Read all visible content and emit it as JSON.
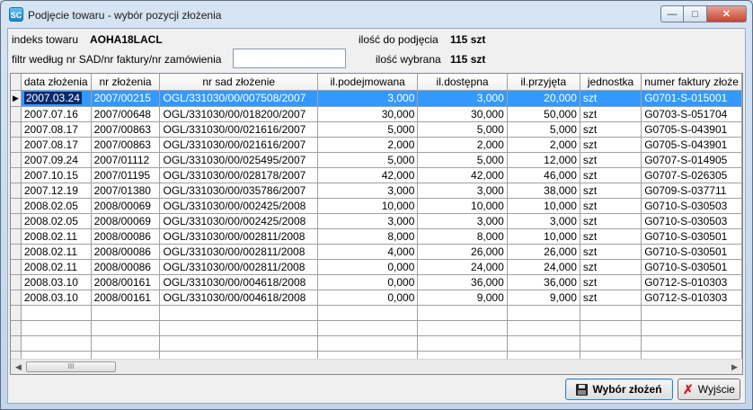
{
  "window": {
    "title": "Podjęcie towaru - wybór pozycji złożenia",
    "app_icon": "SC"
  },
  "header": {
    "index_label": "indeks towaru",
    "index_value": "AOHA18LACL",
    "qty_label": "ilość do podjęcia",
    "qty_value": "115 szt",
    "filter_label": "filtr według nr SAD/nr faktury/nr zamówienia",
    "filter_value": "",
    "selected_label": "ilość wybrana",
    "selected_value": "115 szt"
  },
  "grid": {
    "columns": [
      "data złożenia",
      "nr złożenia",
      "nr sad złożenie",
      "il.podejmowana",
      "il.dostępna",
      "il.przyjęta",
      "jednostka",
      "numer faktury złoże"
    ],
    "rows": [
      [
        "2007.03.24",
        "2007/00215",
        "OGL/331030/00/007508/2007",
        "3,000",
        "3,000",
        "20,000",
        "szt",
        "G0701-S-015001"
      ],
      [
        "2007.07.16",
        "2007/00648",
        "OGL/331030/00/018200/2007",
        "30,000",
        "30,000",
        "50,000",
        "szt",
        "G0703-S-051704"
      ],
      [
        "2007.08.17",
        "2007/00863",
        "OGL/331030/00/021616/2007",
        "5,000",
        "5,000",
        "5,000",
        "szt",
        "G0705-S-043901"
      ],
      [
        "2007.08.17",
        "2007/00863",
        "OGL/331030/00/021616/2007",
        "2,000",
        "2,000",
        "2,000",
        "szt",
        "G0705-S-043901"
      ],
      [
        "2007.09.24",
        "2007/01112",
        "OGL/331030/00/025495/2007",
        "5,000",
        "5,000",
        "12,000",
        "szt",
        "G0707-S-014905"
      ],
      [
        "2007.10.15",
        "2007/01195",
        "OGL/331030/00/028178/2007",
        "42,000",
        "42,000",
        "46,000",
        "szt",
        "G0707-S-026305"
      ],
      [
        "2007.12.19",
        "2007/01380",
        "OGL/331030/00/035786/2007",
        "3,000",
        "3,000",
        "38,000",
        "szt",
        "G0709-S-037711"
      ],
      [
        "2008.02.05",
        "2008/00069",
        "OGL/331030/00/002425/2008",
        "10,000",
        "10,000",
        "10,000",
        "szt",
        "G0710-S-030503"
      ],
      [
        "2008.02.05",
        "2008/00069",
        "OGL/331030/00/002425/2008",
        "3,000",
        "3,000",
        "3,000",
        "szt",
        "G0710-S-030503"
      ],
      [
        "2008.02.11",
        "2008/00086",
        "OGL/331030/00/002811/2008",
        "8,000",
        "8,000",
        "10,000",
        "szt",
        "G0710-S-030501"
      ],
      [
        "2008.02.11",
        "2008/00086",
        "OGL/331030/00/002811/2008",
        "4,000",
        "26,000",
        "26,000",
        "szt",
        "G0710-S-030501"
      ],
      [
        "2008.02.11",
        "2008/00086",
        "OGL/331030/00/002811/2008",
        "0,000",
        "24,000",
        "24,000",
        "szt",
        "G0710-S-030501"
      ],
      [
        "2008.03.10",
        "2008/00161",
        "OGL/331030/00/004618/2008",
        "0,000",
        "36,000",
        "36,000",
        "szt",
        "G0712-S-010303"
      ],
      [
        "2008.03.10",
        "2008/00161",
        "OGL/331030/00/004618/2008",
        "0,000",
        "9,000",
        "9,000",
        "szt",
        "G0712-S-010303"
      ]
    ],
    "selected_row": 0,
    "empty_rows": 4,
    "scroll_thumb_glyph": "III"
  },
  "buttons": {
    "select_label": "Wybór złożeń",
    "exit_label": "Wyjście"
  },
  "icons": {
    "select_button_icon": "floppy-icon",
    "exit_button_icon": "x-icon",
    "row_pointer": "row-pointer-icon"
  },
  "colors": {
    "selection": "#3399ff",
    "title_accent": "#1c86c9",
    "exit_icon": "#d0201a"
  }
}
